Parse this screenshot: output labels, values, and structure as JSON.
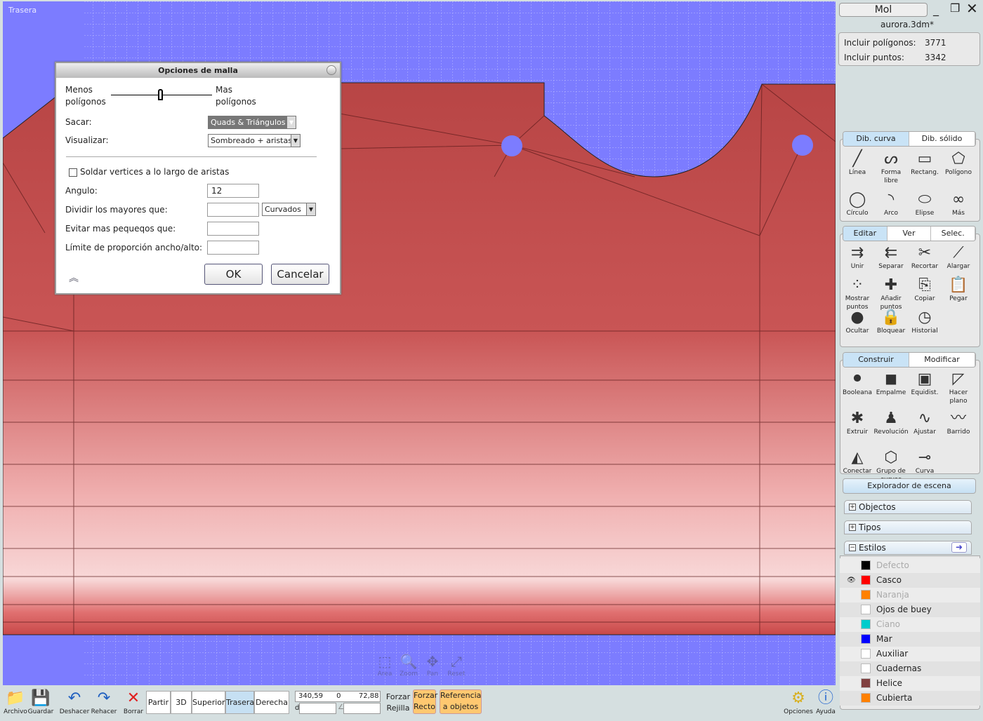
{
  "viewport": {
    "label": "Trasera",
    "nav": [
      {
        "label": "Area",
        "icon": "area-zoom-icon"
      },
      {
        "label": "Zoom",
        "icon": "magnifier-icon"
      },
      {
        "label": "Pan",
        "icon": "pan-arrows-icon"
      },
      {
        "label": "Reset",
        "icon": "reset-expand-icon"
      }
    ]
  },
  "dialog": {
    "title": "Opciones de malla",
    "less": "Menos\npolígonos",
    "more": "Mas\npolígonos",
    "sacar_label": "Sacar:",
    "sacar_value": "Quads & Triángulos",
    "visualizar_label": "Visualizar:",
    "visualizar_value": "Sombreado + aristas",
    "soldar_label": "Soldar vertices a lo largo de aristas",
    "soldar_checked": false,
    "angulo_label": "Angulo:",
    "angulo_value": "12",
    "dividir_label": "Dividir los mayores que:",
    "dividir_value": "",
    "dividir_mode": "Curvados",
    "evitar_label": "Evitar mas pequeqos que:",
    "evitar_value": "",
    "limite_label": "Límite de proporción ancho/alto:",
    "limite_value": "",
    "ok": "OK",
    "cancel": "Cancelar",
    "slider_fraction": 0.5
  },
  "panel": {
    "mode": "Mol",
    "file": "aurora.3dm*",
    "poly_label": "Incluir polígonos:",
    "poly_value": "3771",
    "pts_label": "Incluir puntos:",
    "pts_value": "3342",
    "draw_tabs": [
      "Dib. curva",
      "Dib. sólido"
    ],
    "draw_tools": [
      {
        "label": "Línea",
        "icon": "line-icon"
      },
      {
        "label": "Forma libre",
        "icon": "freeform-icon"
      },
      {
        "label": "Rectang.",
        "icon": "rectangle-icon"
      },
      {
        "label": "Polígono",
        "icon": "polygon-icon"
      },
      {
        "label": "Círculo",
        "icon": "circle-icon"
      },
      {
        "label": "Arco",
        "icon": "arc-icon"
      },
      {
        "label": "Elipse",
        "icon": "ellipse-icon"
      },
      {
        "label": "Más",
        "icon": "helix-icon"
      }
    ],
    "edit_tabs": [
      "Editar",
      "Ver",
      "Selec."
    ],
    "edit_tools": [
      {
        "label": "Unir",
        "icon": "join-icon"
      },
      {
        "label": "Separar",
        "icon": "separate-icon"
      },
      {
        "label": "Recortar",
        "icon": "scissors-icon"
      },
      {
        "label": "Alargar",
        "icon": "extend-icon"
      },
      {
        "label": "Mostrar puntos",
        "icon": "show-points-icon"
      },
      {
        "label": "Añadir puntos",
        "icon": "add-points-icon"
      },
      {
        "label": "Copiar",
        "icon": "copy-icon"
      },
      {
        "label": "Pegar",
        "icon": "paste-icon"
      },
      {
        "label": "Ocultar",
        "icon": "hide-icon"
      },
      {
        "label": "Bloquear",
        "icon": "lock-icon"
      },
      {
        "label": "Historial",
        "icon": "history-icon"
      }
    ],
    "build_tabs": [
      "Construir",
      "Modificar"
    ],
    "build_tools": [
      {
        "label": "Booleana",
        "icon": "boolean-icon"
      },
      {
        "label": "Empalme",
        "icon": "fillet-icon"
      },
      {
        "label": "Equidist.",
        "icon": "offset-icon"
      },
      {
        "label": "Hacer plano",
        "icon": "plane-icon"
      },
      {
        "label": "Extruir",
        "icon": "extrude-icon"
      },
      {
        "label": "Revolución",
        "icon": "revolve-icon"
      },
      {
        "label": "Ajustar",
        "icon": "fit-icon"
      },
      {
        "label": "Barrido",
        "icon": "sweep-icon"
      },
      {
        "label": "Conectar",
        "icon": "loft-icon"
      },
      {
        "label": "Grupo de curvas",
        "icon": "curve-network-icon"
      },
      {
        "label": "Curva",
        "icon": "curve-project-icon"
      }
    ],
    "explorer": "Explorador de escena",
    "objects": "Objectos",
    "types": "Tipos",
    "styles": "Estilos",
    "style_list": [
      {
        "name": "Defecto",
        "color": "#000000",
        "active": false
      },
      {
        "name": "Casco",
        "color": "#ff0000",
        "active": true,
        "visible_icon": true
      },
      {
        "name": "Naranja",
        "color": "#ff8000",
        "active": false
      },
      {
        "name": "Ojos de buey",
        "color": "#ffffff",
        "active": true
      },
      {
        "name": "Ciano",
        "color": "#00cccc",
        "active": false
      },
      {
        "name": "Mar",
        "color": "#0000ff",
        "active": true
      },
      {
        "name": "Auxiliar",
        "color": "#ffffff",
        "active": true
      },
      {
        "name": "Cuadernas",
        "color": "#ffffff",
        "active": true
      },
      {
        "name": "Helice",
        "color": "#804040",
        "active": true
      },
      {
        "name": "Cubierta",
        "color": "#ff8000",
        "active": true
      }
    ]
  },
  "toolbar": {
    "file": "Archivo",
    "save": "Guardar",
    "undo": "Deshacer",
    "redo": "Rehacer",
    "delete": "Borrar",
    "views": [
      "Partir",
      "3D",
      "Superior",
      "Trasera",
      "Derecha"
    ],
    "active_view": "Trasera",
    "coords": "340,59      0        72,88",
    "dist_label": "d",
    "angle_label": "∠",
    "snap_grid": "Forzar\nRejilla",
    "snap_ortho": "Forzar\nRecto",
    "osnap": "Referencia\na objetos",
    "options": "Opciones",
    "help": "Ayuda"
  }
}
